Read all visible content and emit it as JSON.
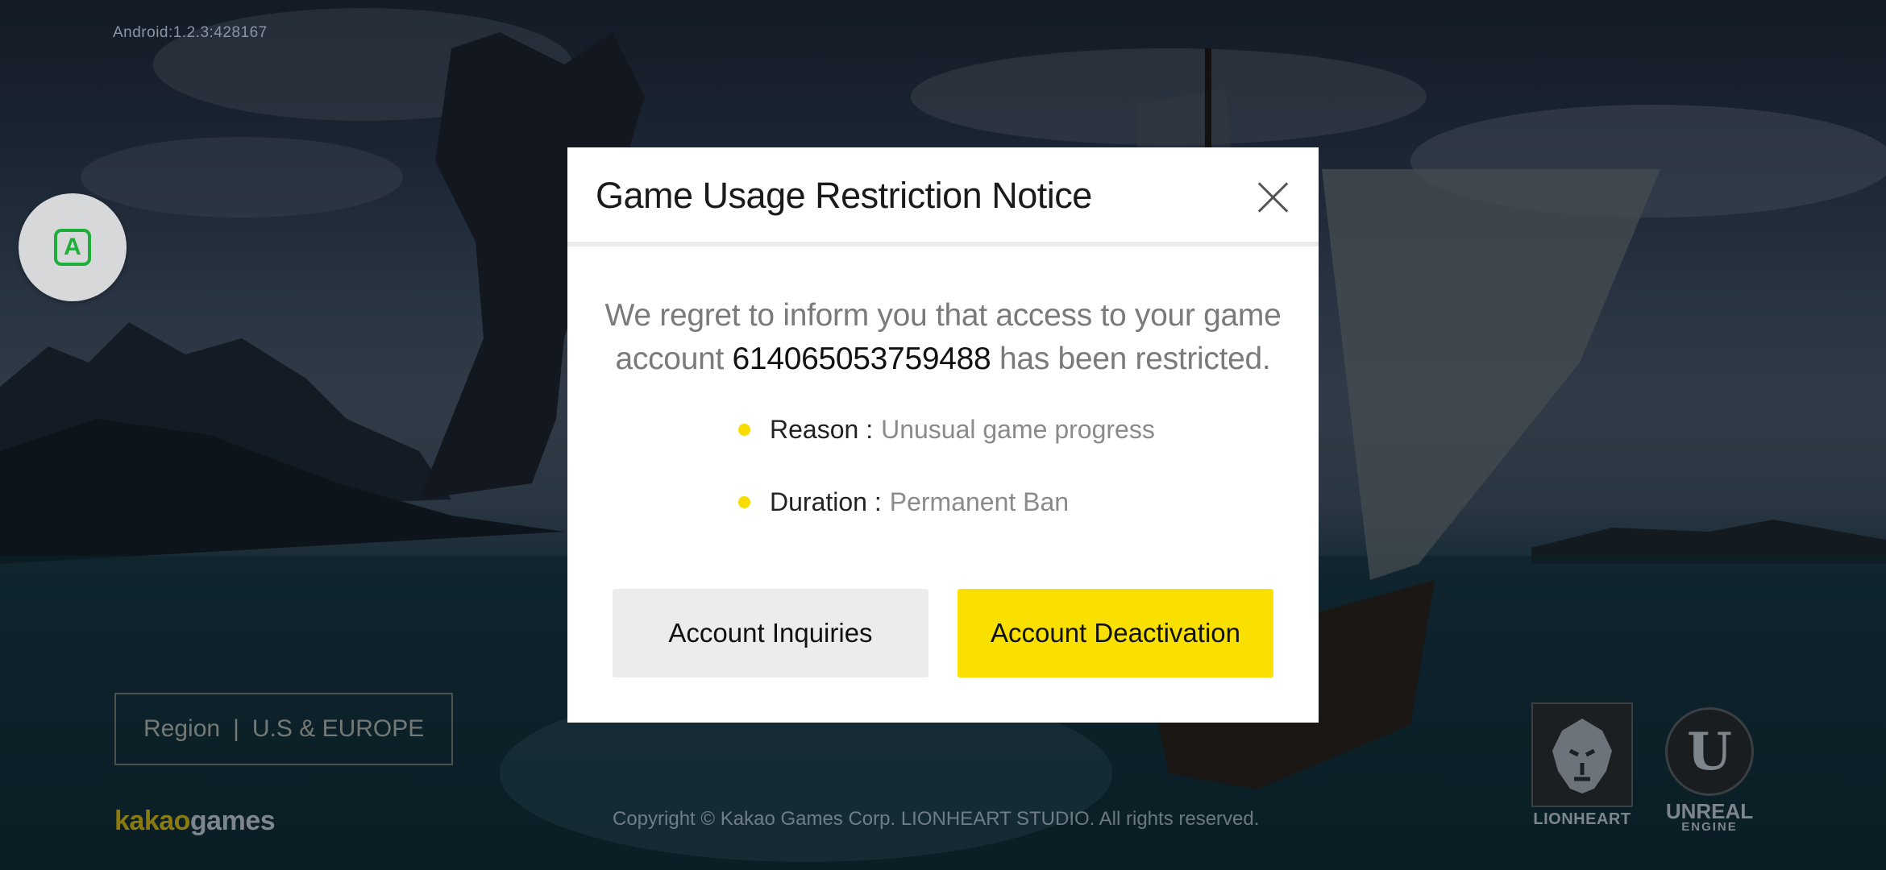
{
  "version": "Android:1.2.3:428167",
  "float_button": {
    "icon": "a-icon",
    "label": "A"
  },
  "region": {
    "label": "Region",
    "separator": "|",
    "value": "U.S & EUROPE"
  },
  "brand": {
    "part1": "kakao",
    "part2": "games"
  },
  "copyright": "Copyright © Kakao Games Corp. LIONHEART STUDIO. All rights reserved.",
  "logos": {
    "lionheart": "LIONHEART",
    "unreal_line1": "UNREAL",
    "unreal_line2": "ENGINE"
  },
  "dialog": {
    "title": "Game Usage Restriction Notice",
    "message_before": "We regret to inform you that access to your game account ",
    "account_id": "614065053759488",
    "message_after": " has been restricted.",
    "reason_label": "Reason :",
    "reason_value": "Unusual game progress",
    "duration_label": "Duration :",
    "duration_value": "Permanent Ban",
    "left_button": "Account Inquiries",
    "right_button": "Account Deactivation"
  },
  "colors": {
    "accent_yellow": "#f9e000",
    "bullet_yellow": "#f6dc00",
    "float_icon_green": "#1fae3a"
  }
}
